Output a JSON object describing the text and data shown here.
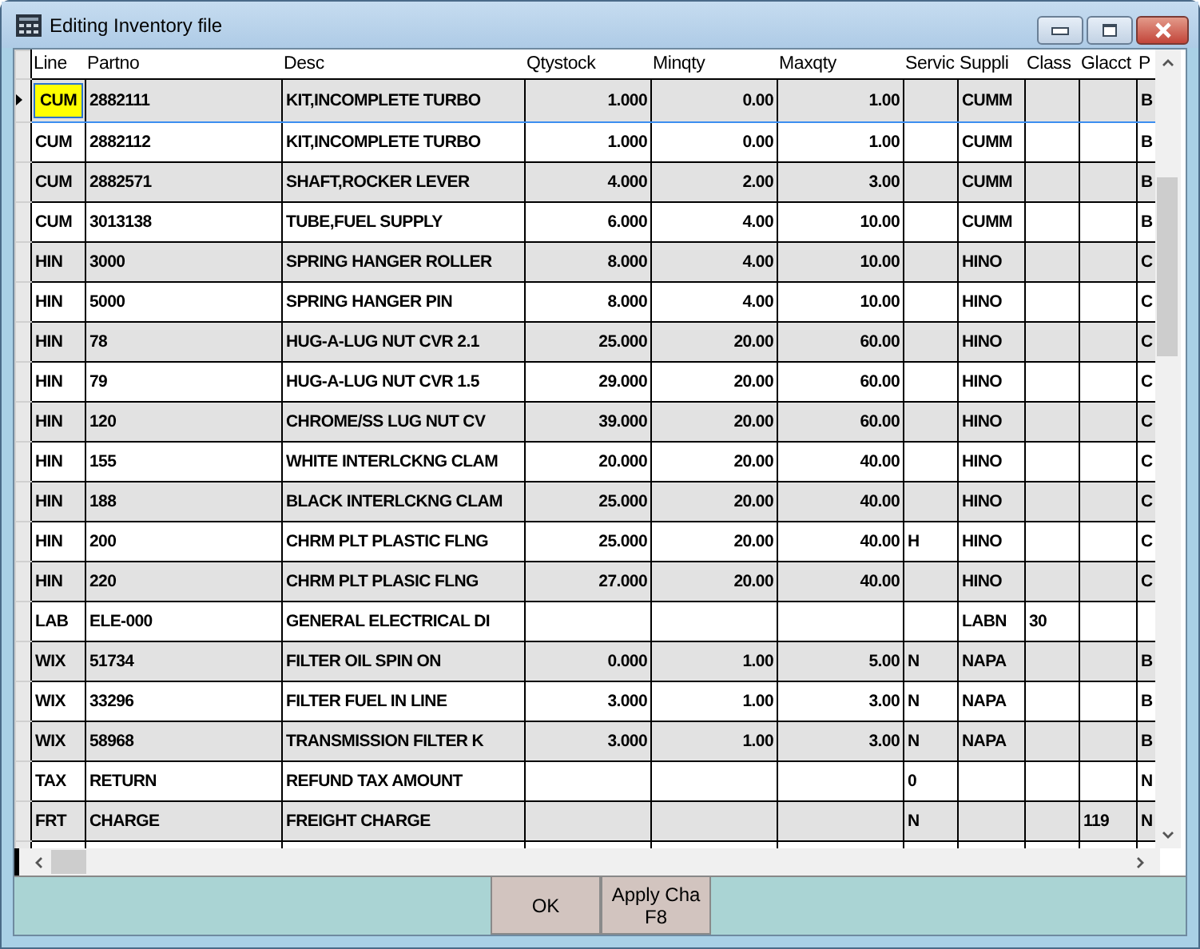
{
  "window": {
    "title": "Editing  Inventory file"
  },
  "table": {
    "columns": [
      "Line",
      "Partno",
      "Desc",
      "Qtystock",
      "Minqty",
      "Maxqty",
      "Servic",
      "Suppli",
      "Class",
      "Glacct",
      "P"
    ],
    "rows": [
      {
        "selected": true,
        "cells": [
          "CUM",
          "2882111",
          "KIT,INCOMPLETE TURBO",
          "1.000",
          "0.00",
          "1.00",
          null,
          "CUMM",
          null,
          null,
          "B"
        ]
      },
      {
        "selected": false,
        "cells": [
          "CUM",
          "2882112",
          "KIT,INCOMPLETE TURBO",
          "1.000",
          "0.00",
          "1.00",
          null,
          "CUMM",
          null,
          null,
          "B"
        ]
      },
      {
        "selected": false,
        "cells": [
          "CUM",
          "2882571",
          "SHAFT,ROCKER LEVER",
          "4.000",
          "2.00",
          "3.00",
          null,
          "CUMM",
          null,
          null,
          "B"
        ]
      },
      {
        "selected": false,
        "cells": [
          "CUM",
          "3013138",
          "TUBE,FUEL SUPPLY",
          "6.000",
          "4.00",
          "10.00",
          null,
          "CUMM",
          null,
          null,
          "B"
        ]
      },
      {
        "selected": false,
        "cells": [
          "HIN",
          "3000",
          "SPRING HANGER ROLLER",
          "8.000",
          "4.00",
          "10.00",
          null,
          "HINO",
          null,
          null,
          "C"
        ]
      },
      {
        "selected": false,
        "cells": [
          "HIN",
          "5000",
          "SPRING HANGER PIN",
          "8.000",
          "4.00",
          "10.00",
          null,
          "HINO",
          null,
          null,
          "C"
        ]
      },
      {
        "selected": false,
        "cells": [
          "HIN",
          "78",
          "HUG-A-LUG NUT CVR 2.1",
          "25.000",
          "20.00",
          "60.00",
          null,
          "HINO",
          null,
          null,
          "C"
        ]
      },
      {
        "selected": false,
        "cells": [
          "HIN",
          "79",
          "HUG-A-LUG NUT CVR 1.5",
          "29.000",
          "20.00",
          "60.00",
          null,
          "HINO",
          null,
          null,
          "C"
        ]
      },
      {
        "selected": false,
        "cells": [
          "HIN",
          "120",
          "CHROME/SS LUG NUT CV",
          "39.000",
          "20.00",
          "60.00",
          null,
          "HINO",
          null,
          null,
          "C"
        ]
      },
      {
        "selected": false,
        "cells": [
          "HIN",
          "155",
          "WHITE INTERLCKNG CLAM",
          "20.000",
          "20.00",
          "40.00",
          null,
          "HINO",
          null,
          null,
          "C"
        ]
      },
      {
        "selected": false,
        "cells": [
          "HIN",
          "188",
          "BLACK INTERLCKNG CLAM",
          "25.000",
          "20.00",
          "40.00",
          null,
          "HINO",
          null,
          null,
          "C"
        ]
      },
      {
        "selected": false,
        "cells": [
          "HIN",
          "200",
          "CHRM PLT PLASTIC FLNG",
          "25.000",
          "20.00",
          "40.00",
          "H",
          "HINO",
          null,
          null,
          "C"
        ]
      },
      {
        "selected": false,
        "cells": [
          "HIN",
          "220",
          "CHRM PLT PLASIC FLNG",
          "27.000",
          "20.00",
          "40.00",
          null,
          "HINO",
          null,
          null,
          "C"
        ]
      },
      {
        "selected": false,
        "cells": [
          "LAB",
          "ELE-000",
          "GENERAL ELECTRICAL DI",
          null,
          null,
          null,
          null,
          "LABN",
          "30",
          null,
          null
        ]
      },
      {
        "selected": false,
        "cells": [
          "WIX",
          "51734",
          "FILTER OIL SPIN ON",
          "0.000",
          "1.00",
          "5.00",
          "N",
          "NAPA",
          null,
          null,
          "B"
        ]
      },
      {
        "selected": false,
        "cells": [
          "WIX",
          "33296",
          "FILTER FUEL IN LINE",
          "3.000",
          "1.00",
          "3.00",
          "N",
          "NAPA",
          null,
          null,
          "B"
        ]
      },
      {
        "selected": false,
        "cells": [
          "WIX",
          "58968",
          "TRANSMISSION FILTER K",
          "3.000",
          "1.00",
          "3.00",
          "N",
          "NAPA",
          null,
          null,
          "B"
        ]
      },
      {
        "selected": false,
        "cells": [
          "TAX",
          "RETURN",
          "REFUND TAX AMOUNT",
          null,
          null,
          null,
          "0",
          null,
          null,
          null,
          "N"
        ]
      },
      {
        "selected": false,
        "cells": [
          "FRT",
          "CHARGE",
          "FREIGHT CHARGE",
          null,
          null,
          null,
          "N",
          null,
          null,
          "119",
          "N"
        ]
      }
    ]
  },
  "buttons": [
    {
      "label": "OK"
    },
    {
      "label": "Apply Cha\nF8"
    }
  ]
}
